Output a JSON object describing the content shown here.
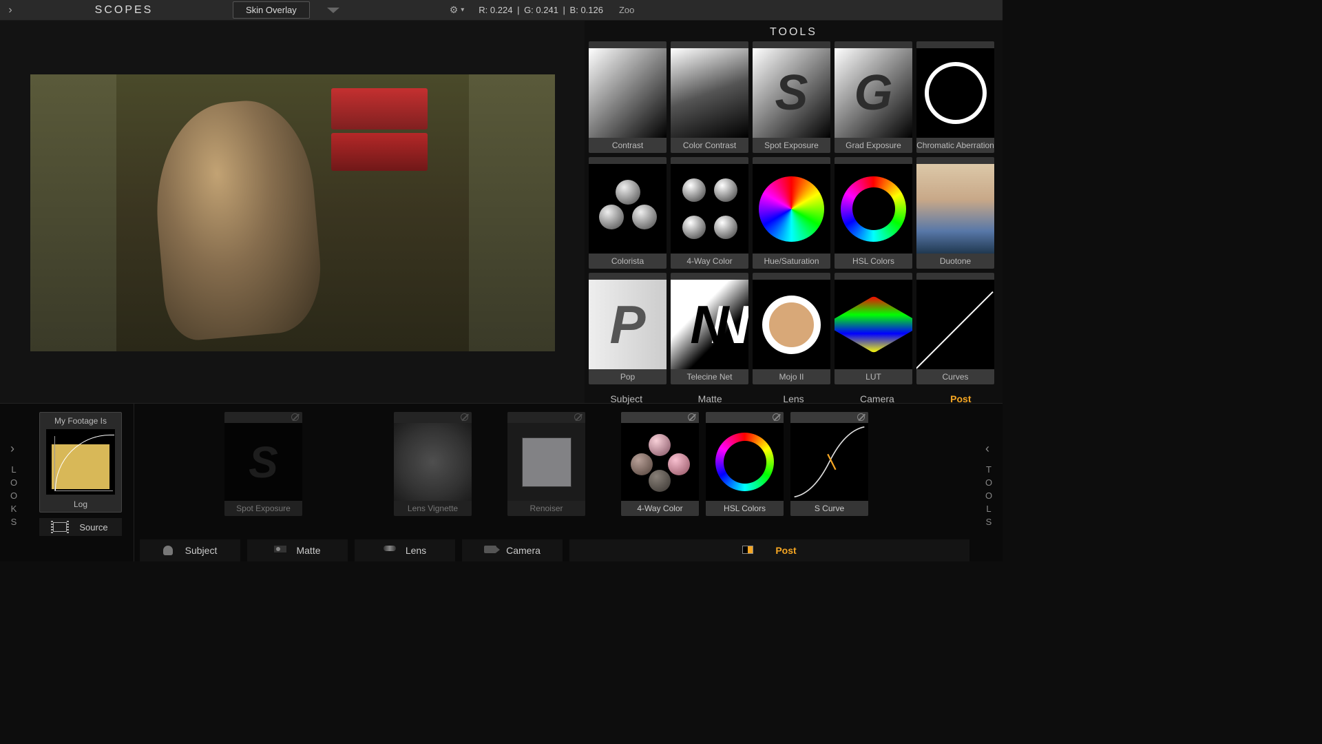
{
  "header": {
    "scopes": "SCOPES",
    "skin_overlay": "Skin Overlay",
    "rgb": {
      "r": "R: 0.224",
      "g": "G: 0.241",
      "b": "B: 0.126"
    },
    "zoom": "Zoo"
  },
  "tools_panel": {
    "title": "TOOLS",
    "tools": [
      {
        "label": "Contrast"
      },
      {
        "label": "Color Contrast"
      },
      {
        "label": "Spot Exposure"
      },
      {
        "label": "Grad Exposure"
      },
      {
        "label": "Chromatic Aberration"
      },
      {
        "label": "Colorista"
      },
      {
        "label": "4-Way Color"
      },
      {
        "label": "Hue/Saturation"
      },
      {
        "label": "HSL Colors"
      },
      {
        "label": "Duotone"
      },
      {
        "label": "Pop"
      },
      {
        "label": "Telecine Net"
      },
      {
        "label": "Mojo II"
      },
      {
        "label": "LUT"
      },
      {
        "label": "Curves"
      }
    ],
    "categories": [
      "Subject",
      "Matte",
      "Lens",
      "Camera",
      "Post"
    ],
    "active_category": "Post"
  },
  "bottom": {
    "looks_rail": "LOOKS",
    "tools_rail": "TOOLS",
    "footage": {
      "title": "My Footage Is",
      "profile": "Log",
      "source": "Source"
    },
    "chain": [
      {
        "label": "Spot Exposure"
      },
      {
        "label": "Lens Vignette"
      },
      {
        "label": "Renoiser"
      },
      {
        "label": "4-Way Color"
      },
      {
        "label": "HSL Colors"
      },
      {
        "label": "S Curve"
      }
    ],
    "chain_tabs": [
      "Subject",
      "Matte",
      "Lens",
      "Camera",
      "Post"
    ],
    "active_chain_tab": "Post"
  }
}
